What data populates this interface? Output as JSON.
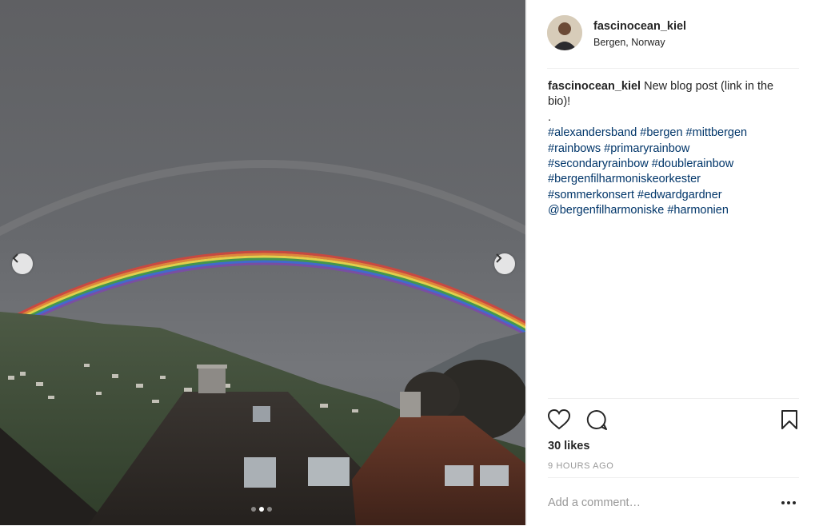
{
  "post": {
    "username": "fascinocean_kiel",
    "location": "Bergen, Norway",
    "caption_user": "fascinocean_kiel",
    "caption_text": "New blog post (link in the bio)!",
    "caption_dot": ".",
    "hashtags": [
      "#alexandersband",
      "#bergen",
      "#mittbergen",
      "#rainbows",
      "#primaryrainbow",
      "#secondaryrainbow",
      "#doublerainbow",
      "#bergenfilharmoniskeorkester",
      "#sommerkonsert",
      "#edwardgardner",
      "@bergenfilharmoniske",
      "#harmonien"
    ],
    "likes": "30 likes",
    "time": "9 HOURS AGO",
    "comment_placeholder": "Add a comment…"
  },
  "carousel": {
    "current": 2,
    "total": 3
  },
  "icons": {
    "like": "heart-icon",
    "comment": "comment-bubble-icon",
    "save": "bookmark-icon",
    "more": "more-options-icon",
    "prev": "chevron-left-icon",
    "next": "chevron-right-icon"
  }
}
